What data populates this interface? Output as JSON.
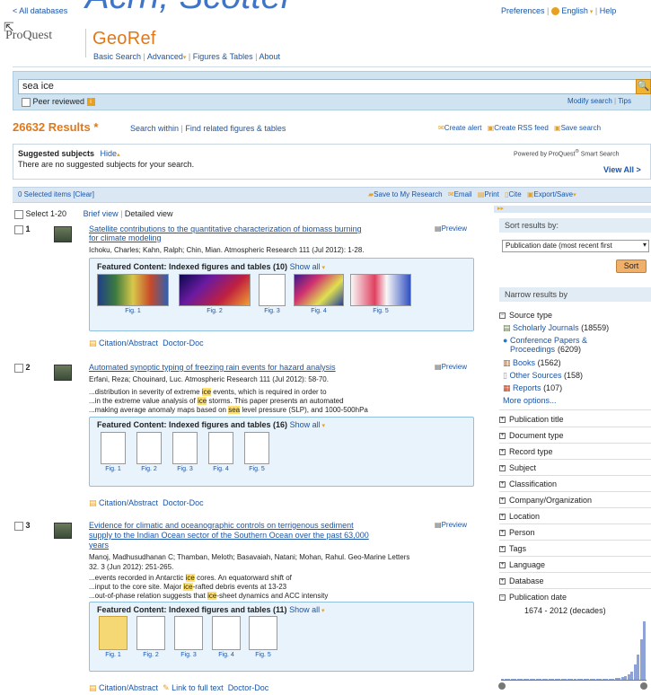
{
  "header": {
    "all_databases": "< All databases",
    "ghost_title": "Acrn, Scotter",
    "product": "ProQuest",
    "database": "GeoRef",
    "preferences": "Preferences",
    "language": "English",
    "help": "Help",
    "nav": [
      "Basic Search",
      "Advanced",
      "Figures & Tables",
      "About"
    ]
  },
  "search": {
    "value": "sea ice",
    "peer_reviewed": "Peer reviewed",
    "modify": "Modify search",
    "tips": "Tips"
  },
  "results": {
    "count": "26632 Results",
    "star": "*",
    "search_within": "Search within",
    "related": "Find related figures & tables",
    "create_alert": "Create alert",
    "create_rss": "Create RSS feed",
    "save_search": "Save search"
  },
  "suggested": {
    "title": "Suggested subjects",
    "hide": "Hide",
    "text": "There are no suggested subjects for your search.",
    "powered": "Powered by ProQuest",
    "smart": "Smart Search",
    "view_all": "View All >"
  },
  "toolbar": {
    "selected": "0 Selected items",
    "clear": "[Clear]",
    "save_research": "Save to My Research",
    "email": "Email",
    "print": "Print",
    "cite": "Cite",
    "export": "Export/Save"
  },
  "list": {
    "select": "Select 1-20",
    "brief": "Brief view",
    "detailed": "Detailed view"
  },
  "items": [
    {
      "num": "1",
      "title1": "Satellite contributions to the quantitative characterization of biomass burning",
      "title2": "for climate modeling",
      "preview": "Preview",
      "meta": "Ichoku, Charles; Kahn, Ralph; Chin, Mian. Atmospheric Research 111 (Jul 2012): 1-28.",
      "featured": "Featured Content: Indexed figures and tables (10)",
      "show_all": "Show all",
      "figs": [
        "Fig. 1",
        "Fig. 2",
        "Fig. 3",
        "Fig. 4",
        "Fig. 5"
      ],
      "links": [
        "Citation/Abstract",
        "Doctor-Doc"
      ]
    },
    {
      "num": "2",
      "title1": "Automated synoptic typing of freezing rain events for hazard analysis",
      "preview": "Preview",
      "meta": "Erfani, Reza; Chouinard, Luc. Atmospheric Research 111 (Jul 2012): 58-70.",
      "snips": [
        [
          "...distribution in severity of extreme ",
          "ice",
          " events, which is required in order to"
        ],
        [
          "...in the extreme value analysis of ",
          "ice",
          " storms. This paper presents an automated"
        ],
        [
          "...making average anomaly maps based on ",
          "sea",
          " level pressure (SLP), and 1000-500hPa"
        ]
      ],
      "featured": "Featured Content: Indexed figures and tables (16)",
      "show_all": "Show all",
      "figs": [
        "Fig. 1",
        "Fig. 2",
        "Fig. 3",
        "Fig. 4",
        "Fig. 5"
      ],
      "links": [
        "Citation/Abstract",
        "Doctor-Doc"
      ]
    },
    {
      "num": "3",
      "title1": "Evidence for climatic and oceanographic controls on terrigenous sediment",
      "title2": "supply to the Indian Ocean sector of the Southern Ocean over the past 63,000",
      "title3": "years",
      "preview": "Preview",
      "meta1": "Manoj, Madhusudhanan C; Thamban, Meloth; Basavaiah, Natani; Mohan, Rahul. Geo-Marine Letters",
      "meta2": "32. 3 (Jun 2012): 251-265.",
      "snips": [
        [
          "...events recorded in Antarctic ",
          "ice",
          " cores. An equatorward shift of"
        ],
        [
          "...input to the core site. Major ",
          "ice",
          "-rafted debris events at 13-23"
        ],
        [
          "...out-of-phase relation suggests that ",
          "ice",
          "-sheet dynamics and ACC intensity"
        ]
      ],
      "featured": "Featured Content: Indexed figures and tables (11)",
      "show_all": "Show all",
      "figs": [
        "Fig. 1",
        "Fig. 2",
        "Fig. 3",
        "Fig. 4",
        "Fig. 5"
      ],
      "links": [
        "Citation/Abstract",
        "Link to full text",
        "Doctor-Doc"
      ]
    }
  ],
  "sidebar": {
    "sort_by": "Sort results by:",
    "sort_value": "Publication date (most recent first",
    "sort_btn": "Sort",
    "narrow": "Narrow results by",
    "source_type": "Source type",
    "sources": [
      {
        "label": "Scholarly Journals",
        "count": "(18559)"
      },
      {
        "label": "Conference Papers & Proceedings",
        "count": "(6209)"
      },
      {
        "label": "Books",
        "count": "(1562)"
      },
      {
        "label": "Other Sources",
        "count": "(158)"
      },
      {
        "label": "Reports",
        "count": "(107)"
      }
    ],
    "more": "More options...",
    "facets": [
      "Publication title",
      "Document type",
      "Record type",
      "Subject",
      "Classification",
      "Company/Organization",
      "Location",
      "Person",
      "Tags",
      "Language",
      "Database",
      "Publication date"
    ],
    "date_range": "1674 - 2012 (decades)",
    "histogram": [
      1,
      1,
      1,
      1,
      1,
      1,
      1,
      1,
      1,
      1,
      1,
      1,
      1,
      1,
      1,
      1,
      1,
      1,
      1,
      1,
      1,
      1,
      1,
      1,
      1,
      1,
      1,
      1,
      1,
      1,
      1,
      1,
      1,
      1,
      1,
      1,
      2,
      2,
      3,
      4,
      6,
      10,
      18,
      30,
      48,
      70
    ]
  }
}
